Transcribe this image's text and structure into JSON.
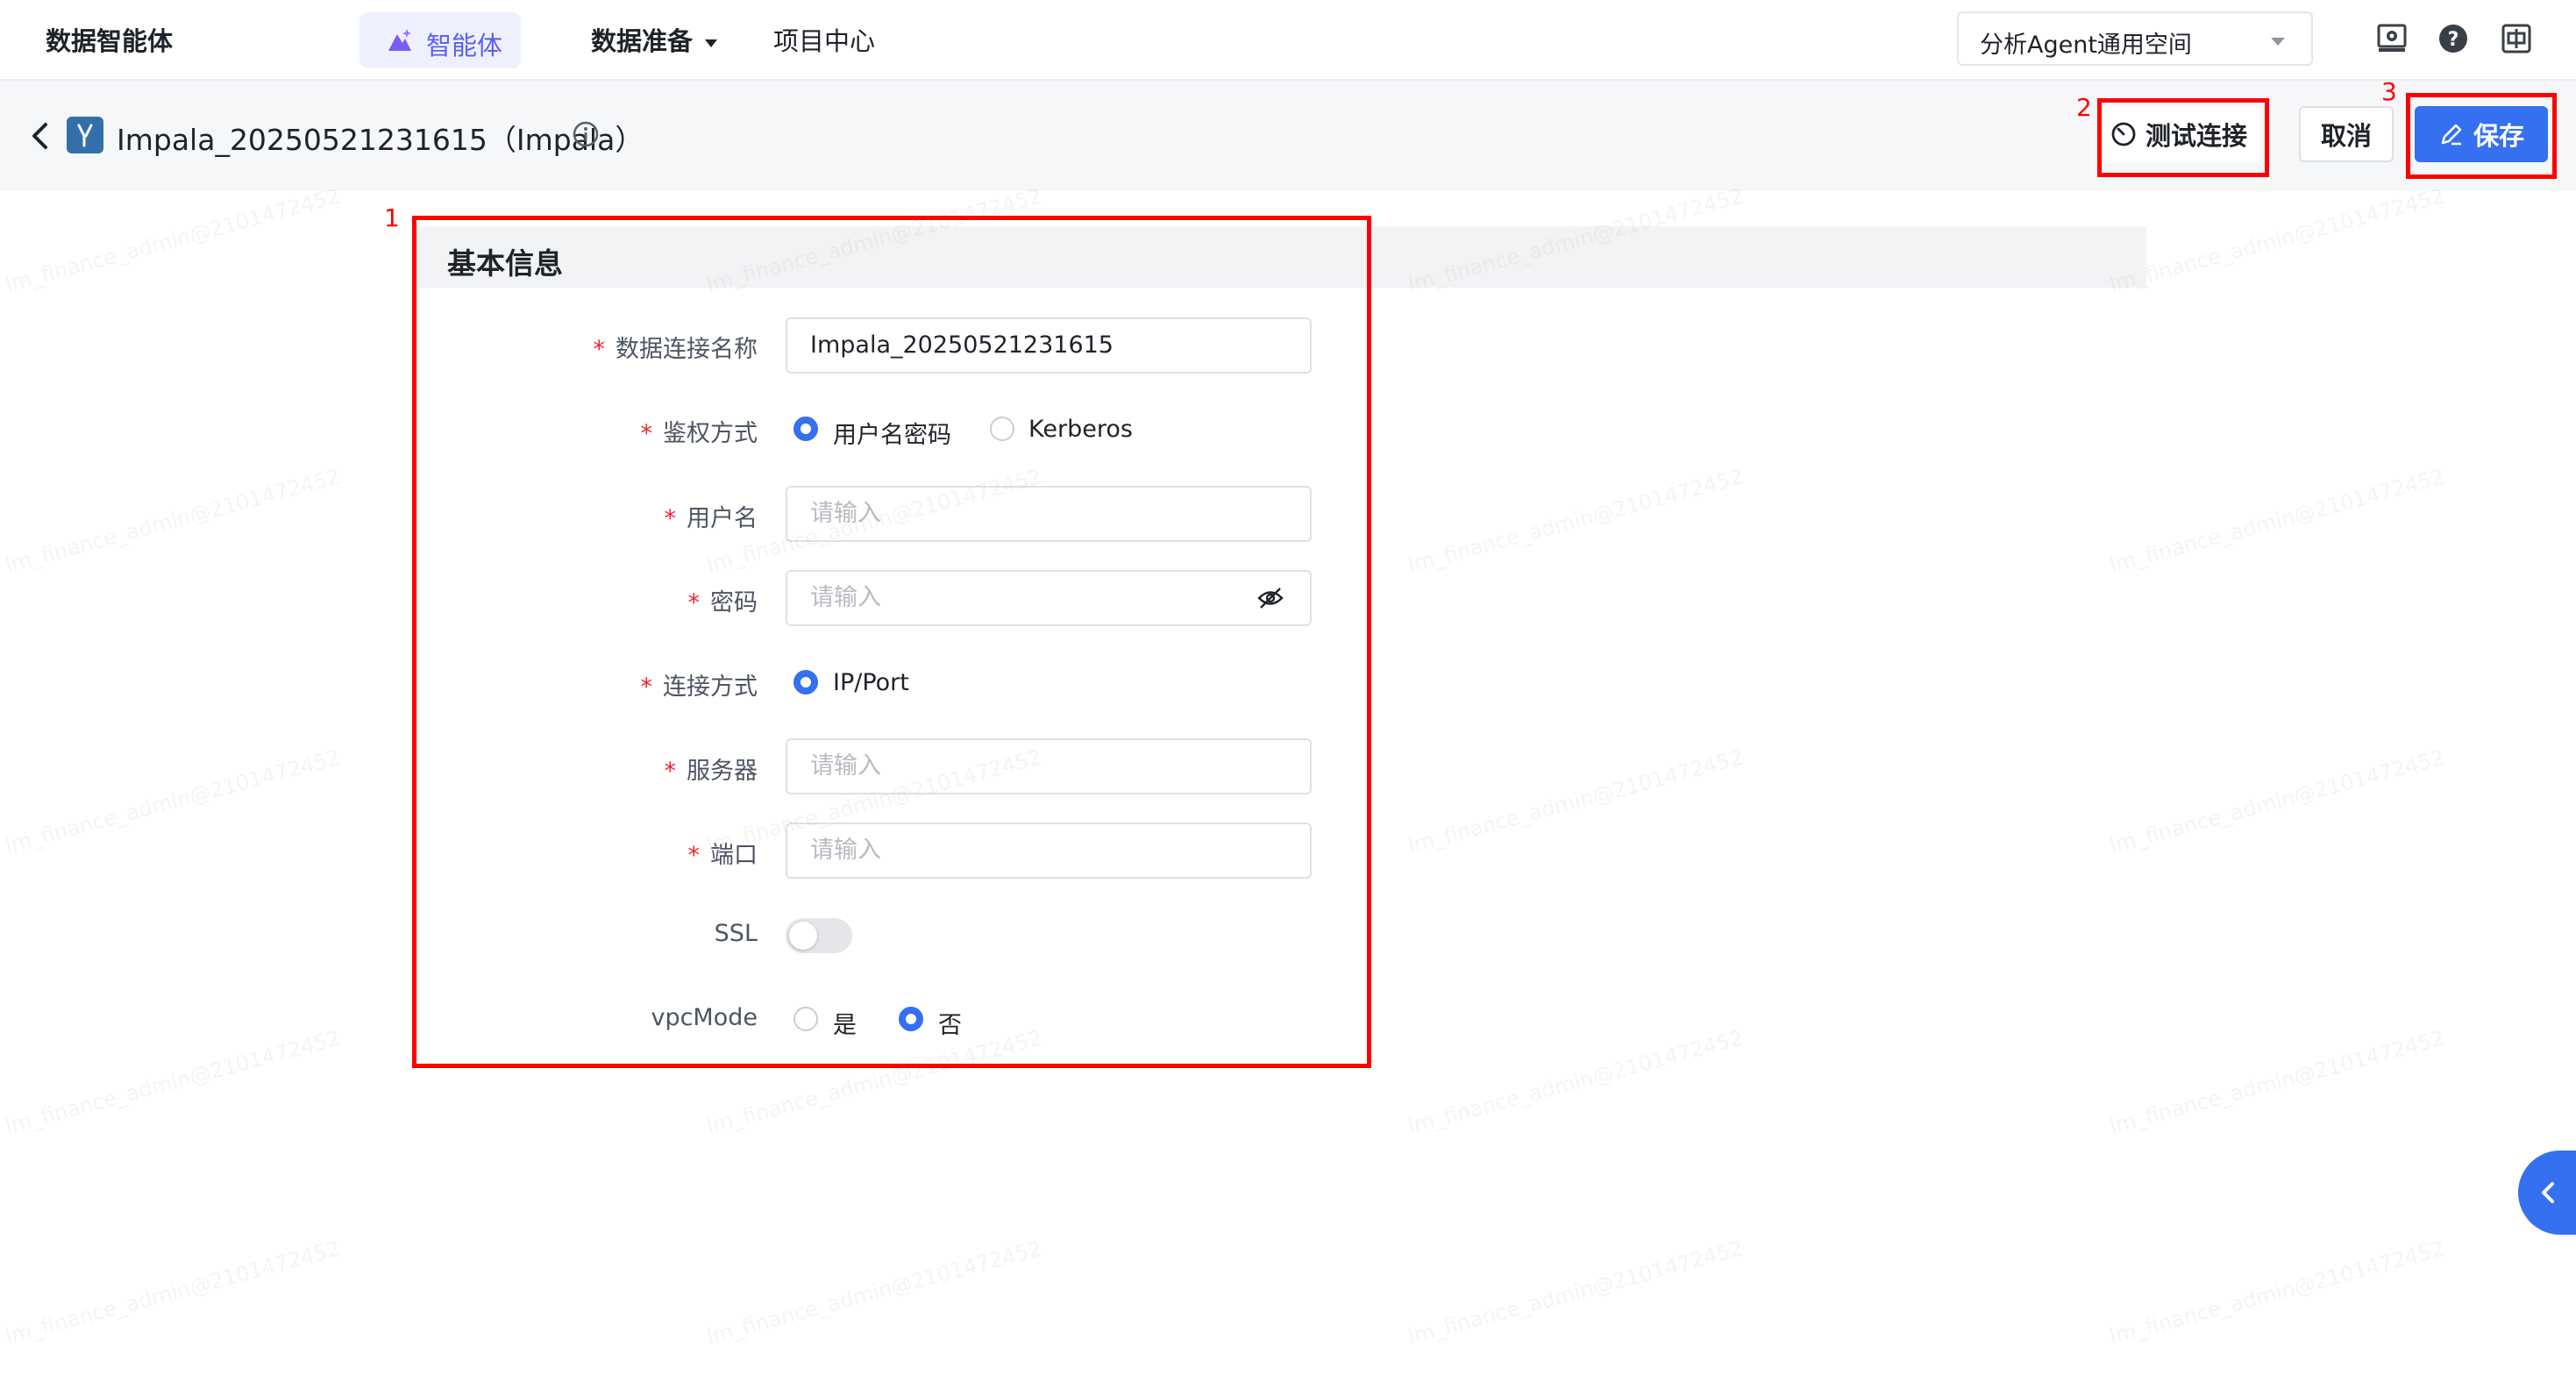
{
  "topnav": {
    "brand": "数据智能体",
    "agent_label": "智能体",
    "prep_label": "数据准备",
    "project_label": "项目中心",
    "workspace": "分析Agent通用空间",
    "icons": [
      "settings-screen-icon",
      "help-icon",
      "language-icon"
    ]
  },
  "header": {
    "title": "Impala_20250521231615（Impala）",
    "test_label": "测试连接",
    "cancel_label": "取消",
    "save_label": "保存"
  },
  "annotations": {
    "box1": "1",
    "box2": "2",
    "box3": "3"
  },
  "form": {
    "section_title": "基本信息",
    "req_mark": "*",
    "conn_name": {
      "label": "数据连接名称",
      "value": "Impala_20250521231615"
    },
    "auth": {
      "label": "鉴权方式",
      "options": [
        "用户名密码",
        "Kerberos"
      ],
      "selected": "用户名密码"
    },
    "username": {
      "label": "用户名",
      "placeholder": "请输入"
    },
    "password": {
      "label": "密码",
      "placeholder": "请输入"
    },
    "conn_method": {
      "label": "连接方式",
      "option": "IP/Port"
    },
    "server": {
      "label": "服务器",
      "placeholder": "请输入"
    },
    "port": {
      "label": "端口",
      "placeholder": "请输入"
    },
    "ssl": {
      "label": "SSL",
      "enabled": false
    },
    "vpcmode": {
      "label": "vpcMode",
      "options": [
        "是",
        "否"
      ],
      "selected": "否"
    }
  },
  "colors": {
    "accent": "#3470ef",
    "annotation": "#ff0000",
    "agent_text": "#5b5ff2"
  },
  "watermark": "lm_finance_admin@2101472452"
}
